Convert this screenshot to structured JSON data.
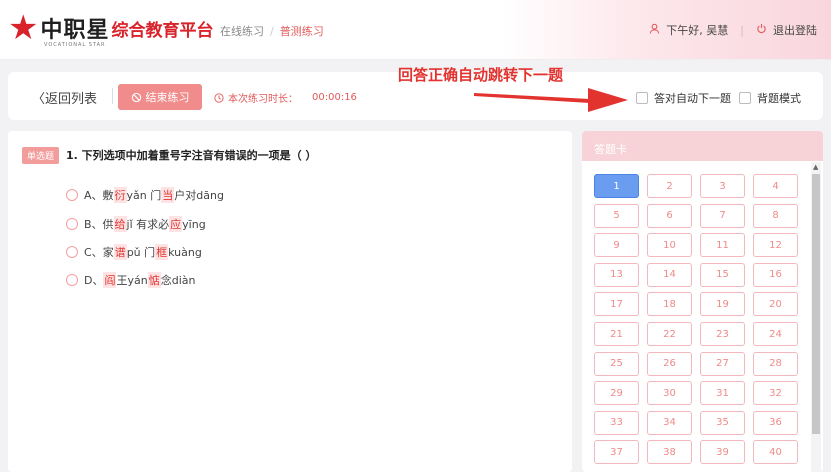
{
  "header": {
    "logo_brand": "中职星",
    "logo_platform": "综合教育平台",
    "logo_subtitle": "VOCATIONAL STAR",
    "breadcrumb": [
      "在线练习",
      "普测练习"
    ],
    "greeting": "下午好, 吴慧",
    "logout": "退出登陆"
  },
  "toolbar": {
    "back_label": "〈返回列表",
    "end_label": "结束练习",
    "timer_label": "本次练习时长：",
    "timer_value": "00:00:16",
    "auto_next_label": "答对自动下一题",
    "memorize_label": "背题模式"
  },
  "annotation": {
    "text": "回答正确自动跳转下一题",
    "color": "#e2332f"
  },
  "question": {
    "type_tag": "单选题",
    "text": "1. 下列选项中加着重号字注音有错误的一项是（ ）",
    "options": [
      {
        "prefix": "A、",
        "parts": [
          "敷",
          "衍",
          "yǎn  门",
          "当",
          "户对dāng"
        ]
      },
      {
        "prefix": "B、",
        "parts": [
          "供",
          "给",
          "jǐ   有求必",
          "应",
          "yīng"
        ]
      },
      {
        "prefix": "C、",
        "parts": [
          "家",
          "谱",
          "pǔ   门",
          "框",
          "kuàng"
        ]
      },
      {
        "prefix": "D、",
        "parts": [
          "",
          "阎",
          "王yán   ",
          "惦",
          "念diàn"
        ]
      }
    ]
  },
  "answer_card": {
    "title": "答题卡",
    "numbers": [
      "1",
      "2",
      "3",
      "4",
      "5",
      "6",
      "7",
      "8",
      "9",
      "10",
      "11",
      "12",
      "13",
      "14",
      "15",
      "16",
      "17",
      "18",
      "19",
      "20",
      "21",
      "22",
      "23",
      "24",
      "25",
      "26",
      "27",
      "28",
      "29",
      "30",
      "31",
      "32",
      "33",
      "34",
      "35",
      "36",
      "37",
      "38",
      "39",
      "40"
    ],
    "current": "1"
  },
  "colors": {
    "accent": "#e25a5a",
    "highlight": "#e2332f",
    "active_cell": "#6a9cf0"
  }
}
